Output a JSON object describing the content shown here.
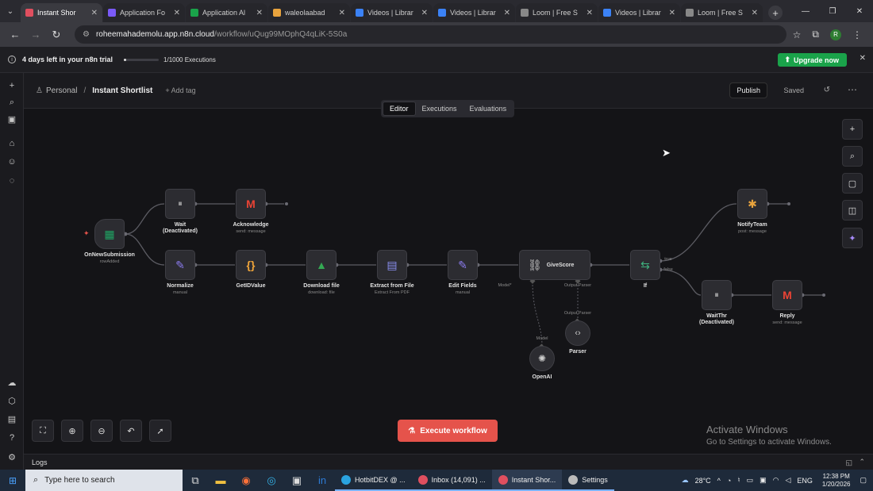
{
  "browser": {
    "tabs": [
      {
        "title": "Instant Shor",
        "color": "#e04f5f",
        "active": true
      },
      {
        "title": "Application Fo",
        "color": "#7a5af8",
        "active": false
      },
      {
        "title": "Application Al",
        "color": "#1aa34a",
        "active": false
      },
      {
        "title": "waleolaabad",
        "color": "#e8a33d",
        "active": false
      },
      {
        "title": "Videos | Librar",
        "color": "#3b82f6",
        "active": false
      },
      {
        "title": "Videos | Librar",
        "color": "#3b82f6",
        "active": false
      },
      {
        "title": "Loom | Free S",
        "color": "#888888",
        "active": false
      },
      {
        "title": "Videos | Librar",
        "color": "#3b82f6",
        "active": false
      },
      {
        "title": "Loom | Free S",
        "color": "#888888",
        "active": false
      }
    ],
    "url_host": "roheemahademolu.app.n8n.cloud",
    "url_path": "/workflow/uQug99MOphQ4qLiK-5S0a",
    "profile_initial": "R"
  },
  "banner": {
    "trial_text": "4 days left in your n8n trial",
    "executions": "1/1000 Executions",
    "usage_fraction": 0.001,
    "upgrade_label": "Upgrade now"
  },
  "header": {
    "project": "Personal",
    "workflow_name": "Instant Shortlist",
    "add_tag": "+ Add tag",
    "publish_label": "Publish",
    "saved_label": "Saved"
  },
  "mode_tabs": [
    "Editor",
    "Executions",
    "Evaluations"
  ],
  "nodes": {
    "trigger": {
      "label": "OnNewSubmission",
      "sub": "rowAdded"
    },
    "wait": {
      "label": "Wait",
      "label2": "(Deactivated)"
    },
    "acknowledge": {
      "label": "Acknowledge",
      "sub": "send: message"
    },
    "normalize": {
      "label": "Normalize",
      "sub": "manual"
    },
    "getidvalue": {
      "label": "GetIDValue"
    },
    "download": {
      "label": "Download file",
      "sub": "download: file"
    },
    "extract": {
      "label": "Extract from File",
      "sub": "Extract From PDF"
    },
    "editfields": {
      "label": "Edit Fields",
      "sub": "manual"
    },
    "givescore": {
      "label": "GiveScore",
      "port_model": "Model*",
      "port_parser": "Output Parser"
    },
    "if": {
      "label": "If",
      "out_true": "true",
      "out_false": "false"
    },
    "notifyteam": {
      "label": "NotifyTeam",
      "sub": "post: message"
    },
    "waitthr": {
      "label": "WaitThr",
      "label2": "(Deactivated)"
    },
    "reply": {
      "label": "Reply",
      "sub": "send: message"
    },
    "parser": {
      "label": "Parser",
      "port": "Output Parser"
    },
    "openai": {
      "label": "OpenAI",
      "port": "Model"
    }
  },
  "execute_label": "Execute workflow",
  "activate": {
    "line1": "Activate Windows",
    "line2": "Go to Settings to activate Windows."
  },
  "logs_label": "Logs",
  "taskbar": {
    "search_placeholder": "Type here to search",
    "apps": [
      {
        "label": "HotbitDEX @ ...",
        "color": "#2aa3e0",
        "active": false
      },
      {
        "label": "Inbox (14,091) ...",
        "color": "#e04f5f",
        "active": false
      },
      {
        "label": "Instant Shor...",
        "color": "#e04f5f",
        "active": true
      },
      {
        "label": "Settings",
        "color": "#bbbbbb",
        "active": false
      }
    ],
    "temperature": "28°C",
    "language": "ENG",
    "time": "12:38 PM",
    "date": "1/20/2026"
  }
}
